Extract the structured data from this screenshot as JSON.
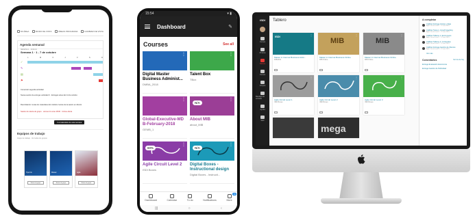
{
  "phone1": {
    "tabs": [
      "MI ÁREA",
      "MODO DE VISTA",
      "ÁREAS PROGRAMA",
      "CAMBIAR DE VISTA"
    ],
    "agenda_title": "Agenda semanal",
    "week_sub": "SEMANA 1 · 2019-10",
    "week_label": "Semana 1 · 1 - 7 de octubre",
    "days": [
      "L",
      "M",
      "X",
      "J",
      "V",
      "S",
      "D"
    ],
    "events": [
      "Comenzar segunda actividad",
      "Nueva sesión de entrega: actividad 3 · Entregar antes del 14 de octubre",
      "Recordatorio: revisa los materiales del módulo 2 antes de la sesión en directo",
      "Sesión de tutoría de grupo · viernes 11 a las 18:00 · Unirse ahora"
    ],
    "view_button": "Ir al calendario de esta semana",
    "groups_title": "Equipos de trabajo",
    "groups_sub": "Grupo de trabajo · Ver todos los grupos",
    "mini_courses": [
      {
        "label": "Tipo Fin",
        "button": "Entrar al grupo",
        "color": "#1d5fa8"
      },
      {
        "label": "Máster",
        "button": "Entrar al grupo",
        "color": "#1f63b2"
      },
      {
        "label": "Agile",
        "button": "Entrar al grupo",
        "color": "#8c2f3a"
      }
    ]
  },
  "phone2": {
    "status_time": "15:54",
    "status_icons": "▾ ▮",
    "appbar_title": "Dashboard",
    "section_title": "Courses",
    "see_all": "See all",
    "courses": [
      {
        "name": "Digital Master Business Administ...",
        "sub": "DMBA_2018",
        "color": "#2369b8",
        "badge": ""
      },
      {
        "name": "Talent Box",
        "sub": "TBox",
        "color": "#3da84a",
        "badge": ""
      },
      {
        "name": "Global-Executive-MD B-February-2018",
        "sub": "GEMB_1",
        "color": "#a23fa0",
        "badge": ""
      },
      {
        "name": "About MIB",
        "sub": "about_MIB",
        "color": "#9b3e96",
        "badge": "N/A"
      },
      {
        "name": "Agile Circuit Level 2",
        "sub": "ISDI Boxes",
        "color": "#8a3ca6",
        "badge": "60%"
      },
      {
        "name": "Digital Boxes - Instructional design",
        "sub": "Digital Boxes - Instructi...",
        "color": "#1c9ab8",
        "badge": "N/A"
      }
    ],
    "nav": [
      "Dashboard",
      "Calendar",
      "To do",
      "Notifications",
      "More"
    ],
    "nav_badge": "36",
    "sys": [
      "|||",
      "○",
      "‹"
    ]
  },
  "monitor": {
    "logo": "ISDI",
    "side": [
      "Cursos",
      "Mi área",
      "Tablero",
      "Cursos",
      "Grupos",
      "Bandeja de entrada",
      "Ayuda",
      "Salir",
      "Conectarse"
    ],
    "page_title": "Tablero",
    "tiles": [
      {
        "name": "Master in Internet Business Admi...",
        "sub": "MIB2019",
        "color": "#157a86",
        "tag": "ISDI"
      },
      {
        "name": "Master in Internet Business Online",
        "sub": "MIB Online",
        "color": "#c3a15c",
        "tag": "MIB"
      },
      {
        "name": "Master in Internet Business Online",
        "sub": "MIB Online",
        "color": "#8a8a8a",
        "tag": "MIB"
      },
      {
        "name": "Agile Circuit Level 1",
        "sub": "ISDI Boxes",
        "color": "#9c9c9c",
        "tag": ""
      },
      {
        "name": "Agile Circuit Level 2",
        "sub": "ISDI Boxes",
        "color": "#4a8cab",
        "tag": ""
      },
      {
        "name": "Agile Circuit Level 3",
        "sub": "ISDI Boxes",
        "color": "#48b04a",
        "tag": ""
      },
      {
        "name": "",
        "sub": "",
        "color": "#3a3a3a",
        "tag": ""
      },
      {
        "name": "",
        "sub": "",
        "color": "#2e2e2e",
        "tag": "mega"
      }
    ],
    "todo_title": "A completar",
    "todos": [
      {
        "title": "Calificar Entrega Ventas y Rate",
        "date": "Agile Circuit Level 1 · 12 mar 2019"
      },
      {
        "title": "Calificar Tarea 1. Growth Hacking",
        "date": "Agile Circuit Level 1 · 12 mar 2019"
      },
      {
        "title": "Calificar Talleres 1. Ecommerce",
        "date": "Agile Circuit Level 1 · 12 mar 2019"
      },
      {
        "title": "Calificar Talleres 2. Contenidos",
        "date": "Agile Circuit Level 2 · 12 mar 2019"
      },
      {
        "title": "Calificar Entrega Gestión de Clientes",
        "date": "Agile Circuit Level 3 · 12 mar 2019"
      }
    ],
    "see_more": "Ver más",
    "recent_title": "Comentarios",
    "recent_link": "Ver los de hoy",
    "news": [
      "Entrega Evaluación Económica",
      "Entrega Gestión de Publicidad"
    ]
  },
  "colors": {
    "accent": "#e53935",
    "link": "#1e88a8",
    "app_bar": "#222222"
  }
}
